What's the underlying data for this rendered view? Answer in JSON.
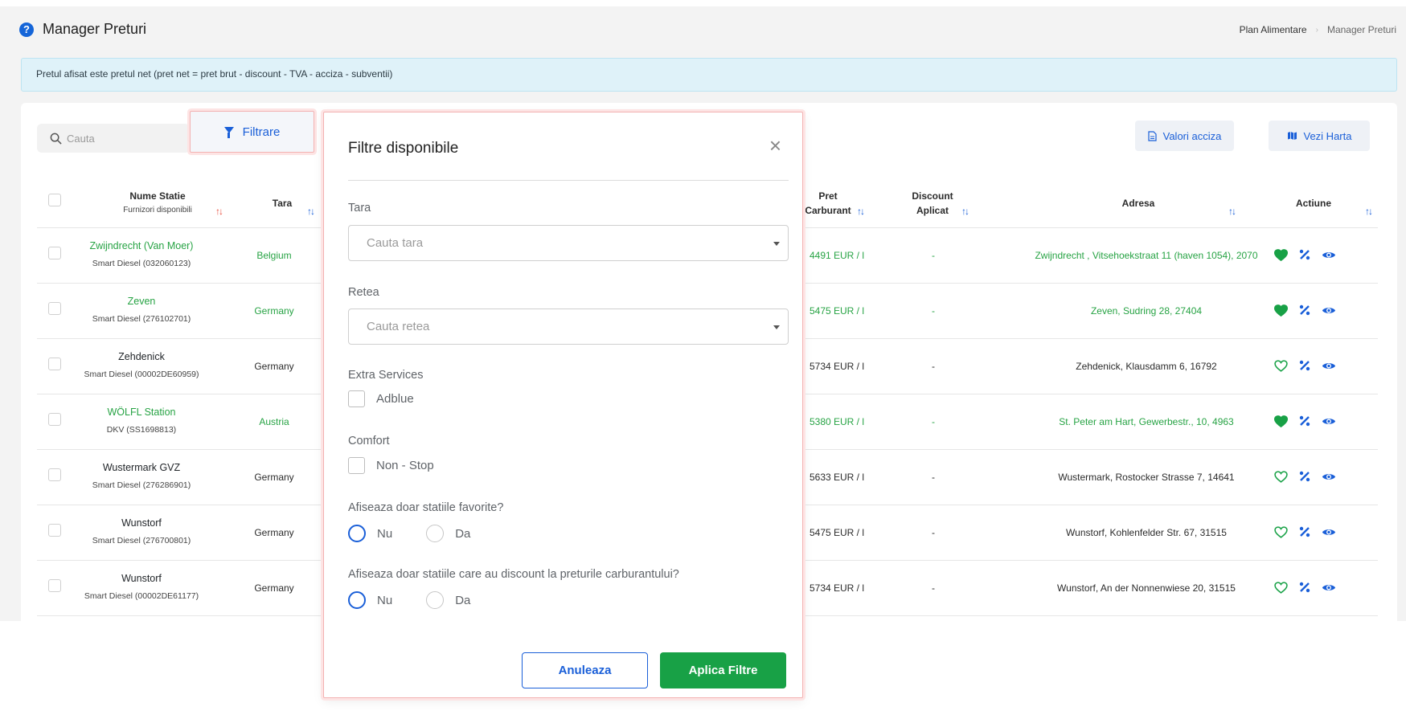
{
  "header": {
    "title": "Manager Preturi",
    "breadcrumb": [
      "Plan Alimentare",
      "Manager Preturi"
    ]
  },
  "info_text": "Pretul afisat este pretul net (pret net = pret brut - discount - TVA - acciza - subventii)",
  "toolbar": {
    "search_placeholder": "Cauta",
    "filter_label": "Filtrare",
    "excise_label": "Valori acciza",
    "map_label": "Vezi Harta"
  },
  "table": {
    "columns": {
      "name": "Nume Statie",
      "name_sub": "Furnizori disponibili",
      "country": "Tara",
      "price": "Pret",
      "price_sub": "Carburant",
      "discount": "Discount",
      "discount_sub": "Aplicat",
      "address": "Adresa",
      "action": "Actiune"
    },
    "rows": [
      {
        "name": "Zwijndrecht (Van Moer)",
        "supplier": "Smart Diesel (032060123)",
        "country": "Belgium",
        "price": "4491 EUR / l",
        "discount": "-",
        "address": "Zwijndrecht , Vitsehoekstraat 11 (haven 1054), 2070",
        "favorite": true
      },
      {
        "name": "Zeven",
        "supplier": "Smart Diesel (276102701)",
        "country": "Germany",
        "price": "5475 EUR / l",
        "discount": "-",
        "address": "Zeven, Sudring 28, 27404",
        "favorite": true
      },
      {
        "name": "Zehdenick",
        "supplier": "Smart Diesel (00002DE60959)",
        "country": "Germany",
        "price": "5734 EUR / l",
        "discount": "-",
        "address": "Zehdenick, Klausdamm 6, 16792",
        "favorite": false
      },
      {
        "name": "WÖLFL Station",
        "supplier": "DKV (SS1698813)",
        "country": "Austria",
        "price": "5380 EUR / l",
        "discount": "-",
        "address": "St. Peter am Hart, Gewerbestr., 10, 4963",
        "favorite": true
      },
      {
        "name": "Wustermark GVZ",
        "supplier": "Smart Diesel (276286901)",
        "country": "Germany",
        "price": "5633 EUR / l",
        "discount": "-",
        "address": "Wustermark, Rostocker Strasse 7, 14641",
        "favorite": false
      },
      {
        "name": "Wunstorf",
        "supplier": "Smart Diesel (276700801)",
        "country": "Germany",
        "price": "5475 EUR / l",
        "discount": "-",
        "address": "Wunstorf, Kohlenfelder Str. 67, 31515",
        "favorite": false
      },
      {
        "name": "Wunstorf",
        "supplier": "Smart Diesel (00002DE61177)",
        "country": "Germany",
        "price": "5734 EUR / l",
        "discount": "-",
        "address": "Wunstorf, An der Nonnenwiese 20, 31515",
        "favorite": false
      }
    ]
  },
  "modal": {
    "title": "Filtre disponibile",
    "country_label": "Tara",
    "country_placeholder": "Cauta tara",
    "network_label": "Retea",
    "network_placeholder": "Cauta retea",
    "extra_label": "Extra Services",
    "adblue_label": "Adblue",
    "comfort_label": "Comfort",
    "nonstop_label": "Non - Stop",
    "fav_question": "Afiseaza doar statiile favorite?",
    "discount_question": "Afiseaza doar statiile care au discount la preturile carburantului?",
    "no_label": "Nu",
    "yes_label": "Da",
    "fav_selected": "Nu",
    "discount_selected": "Nu",
    "cancel_label": "Anuleaza",
    "apply_label": "Aplica Filtre"
  },
  "colors": {
    "primary": "#1a5fd8",
    "success": "#18a146",
    "green_text": "#27a344"
  },
  "icons": [
    "help-icon",
    "search-icon",
    "filter-icon",
    "file-icon",
    "map-icon",
    "close-icon",
    "caret-down-icon",
    "heart-icon",
    "percent-icon",
    "eye-icon"
  ]
}
